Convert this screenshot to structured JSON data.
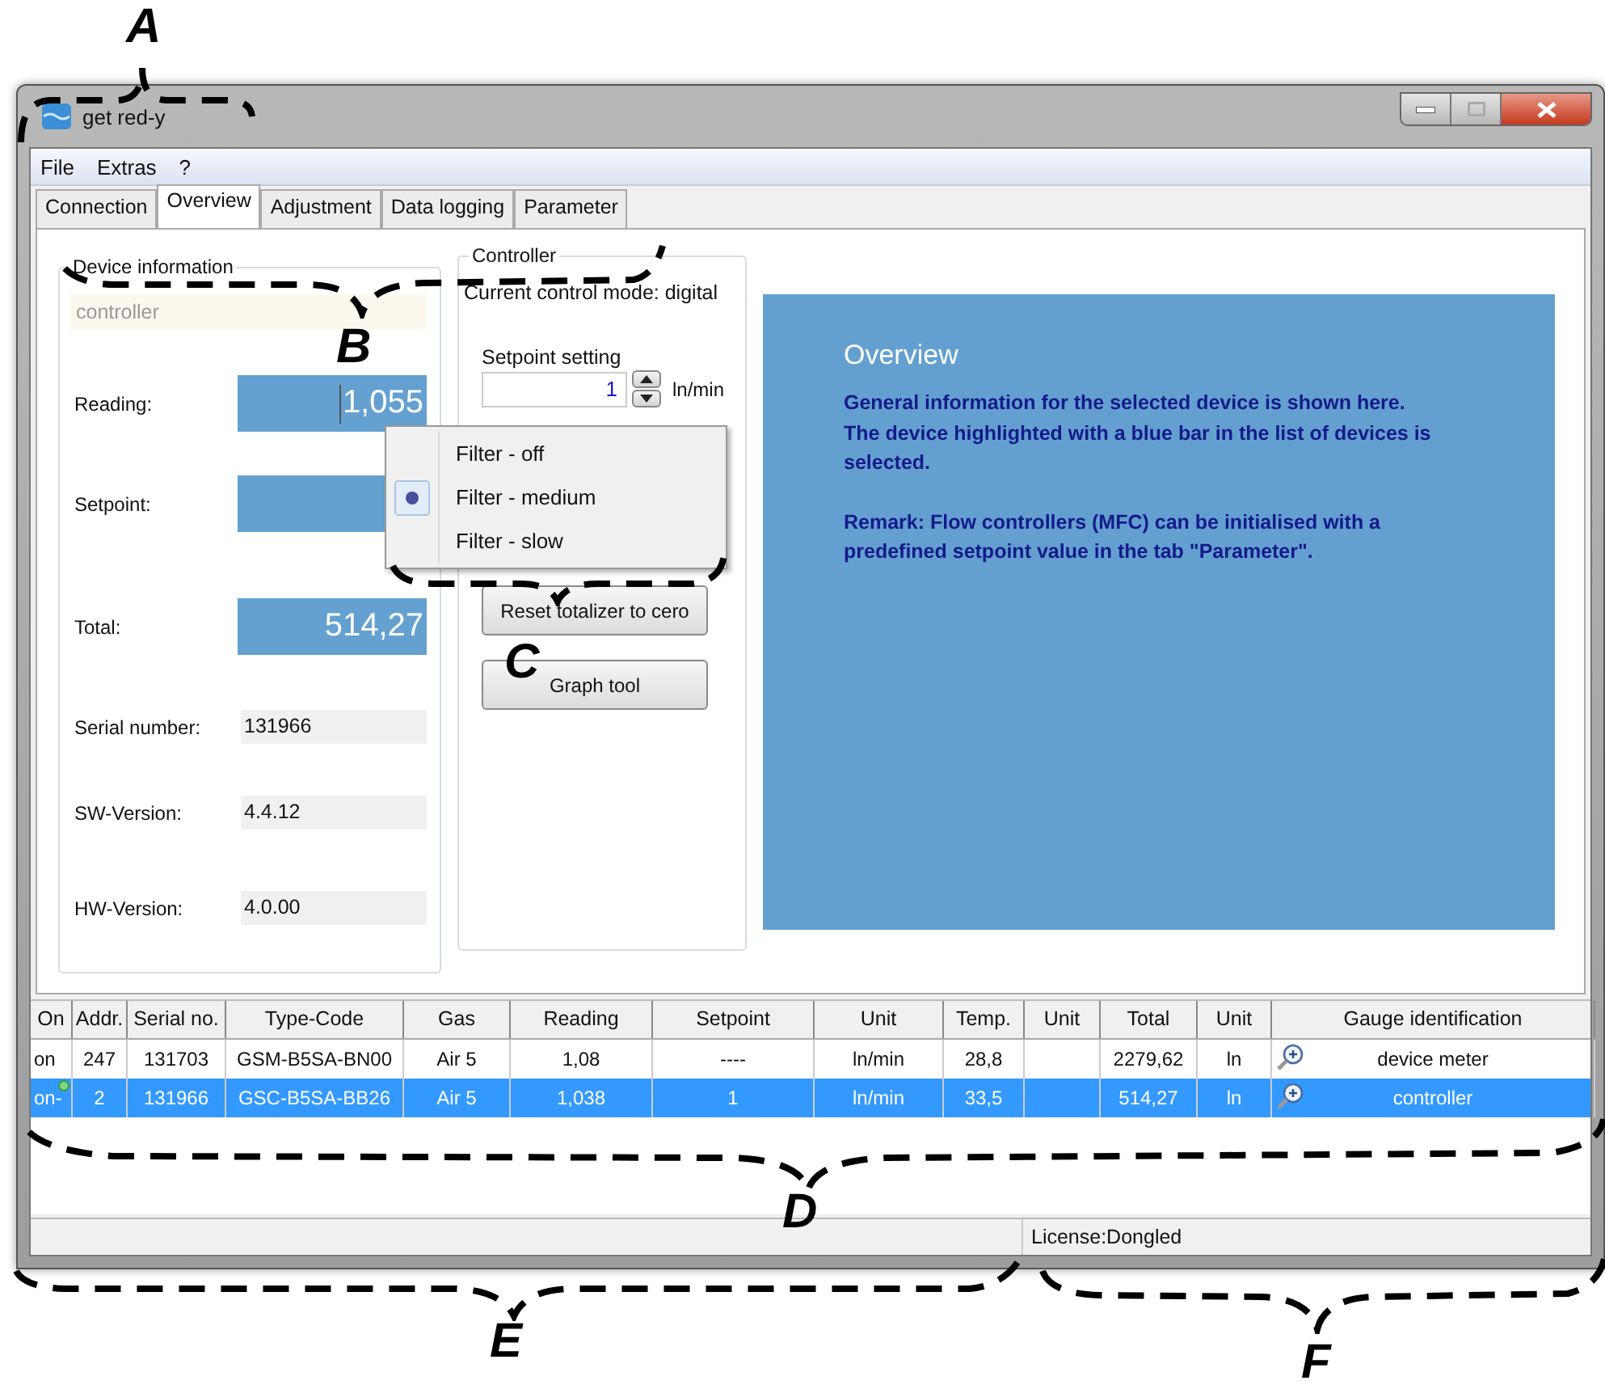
{
  "window": {
    "title": "get red-y"
  },
  "menu": [
    "File",
    "Extras",
    "?"
  ],
  "tabs": [
    {
      "label": "Connection",
      "selected": false
    },
    {
      "label": "Overview",
      "selected": true
    },
    {
      "label": "Adjustment",
      "selected": false
    },
    {
      "label": "Data logging",
      "selected": false
    },
    {
      "label": "Parameter",
      "selected": false
    }
  ],
  "device_information": {
    "title": "Device information",
    "name": "controller",
    "measures": [
      {
        "label": "Reading:",
        "value": "1,055",
        "cursor": true
      },
      {
        "label": "Setpoint:",
        "cursor": false
      },
      {
        "label": "Total:",
        "value": "514,27",
        "cursor": false
      }
    ],
    "details": [
      {
        "label": "Serial number:",
        "value": "131966"
      },
      {
        "label": "SW-Version:",
        "value": "4.4.12"
      },
      {
        "label": "HW-Version:",
        "value": "4.0.00"
      }
    ]
  },
  "controller": {
    "title": "Controller",
    "mode": "Current control mode: digital",
    "setpoint_label": "Setpoint setting",
    "setpoint_value": "1",
    "unit": "ln/min",
    "buttons": [
      "Reset totalizer to cero",
      "Graph tool"
    ]
  },
  "filter_menu": [
    {
      "label": "Filter - off",
      "selected": false
    },
    {
      "label": "Filter - medium",
      "selected": true
    },
    {
      "label": "Filter - slow",
      "selected": false
    }
  ],
  "overview": {
    "title": "Overview",
    "paragraphs": [
      "General information for the selected device is shown here.\nThe device highlighted with a blue bar in the list of devices is selected.",
      "Remark: Flow controllers (MFC) can be initialised with a predefined setpoint value in the tab \"Parameter\"."
    ]
  },
  "table": {
    "columns": [
      "On",
      "Addr.",
      "Serial no.",
      "Type-Code",
      "Gas",
      "Reading",
      "Setpoint",
      "Unit",
      "Temp.",
      "Unit",
      "Total",
      "Unit",
      "Gauge identification"
    ],
    "rows": [
      {
        "selected": false,
        "status_dot": false,
        "cells": [
          "on",
          "247",
          "131703",
          "GSM-B5SA-BN00",
          "Air 5",
          "1,08",
          "----",
          "ln/min",
          "28,8",
          "",
          "2279,62",
          "ln",
          "device meter"
        ]
      },
      {
        "selected": true,
        "status_dot": true,
        "cells": [
          "on-",
          "2",
          "131966",
          "GSC-B5SA-BB26",
          "Air 5",
          "1,038",
          "1",
          "ln/min",
          "33,5",
          "",
          "514,27",
          "ln",
          "controller"
        ]
      }
    ]
  },
  "status_bar": {
    "license": "License:Dongled"
  },
  "annotations": [
    {
      "label": "A"
    },
    {
      "label": "B"
    },
    {
      "label": "C"
    },
    {
      "label": "D"
    },
    {
      "label": "E"
    },
    {
      "label": "F"
    }
  ]
}
